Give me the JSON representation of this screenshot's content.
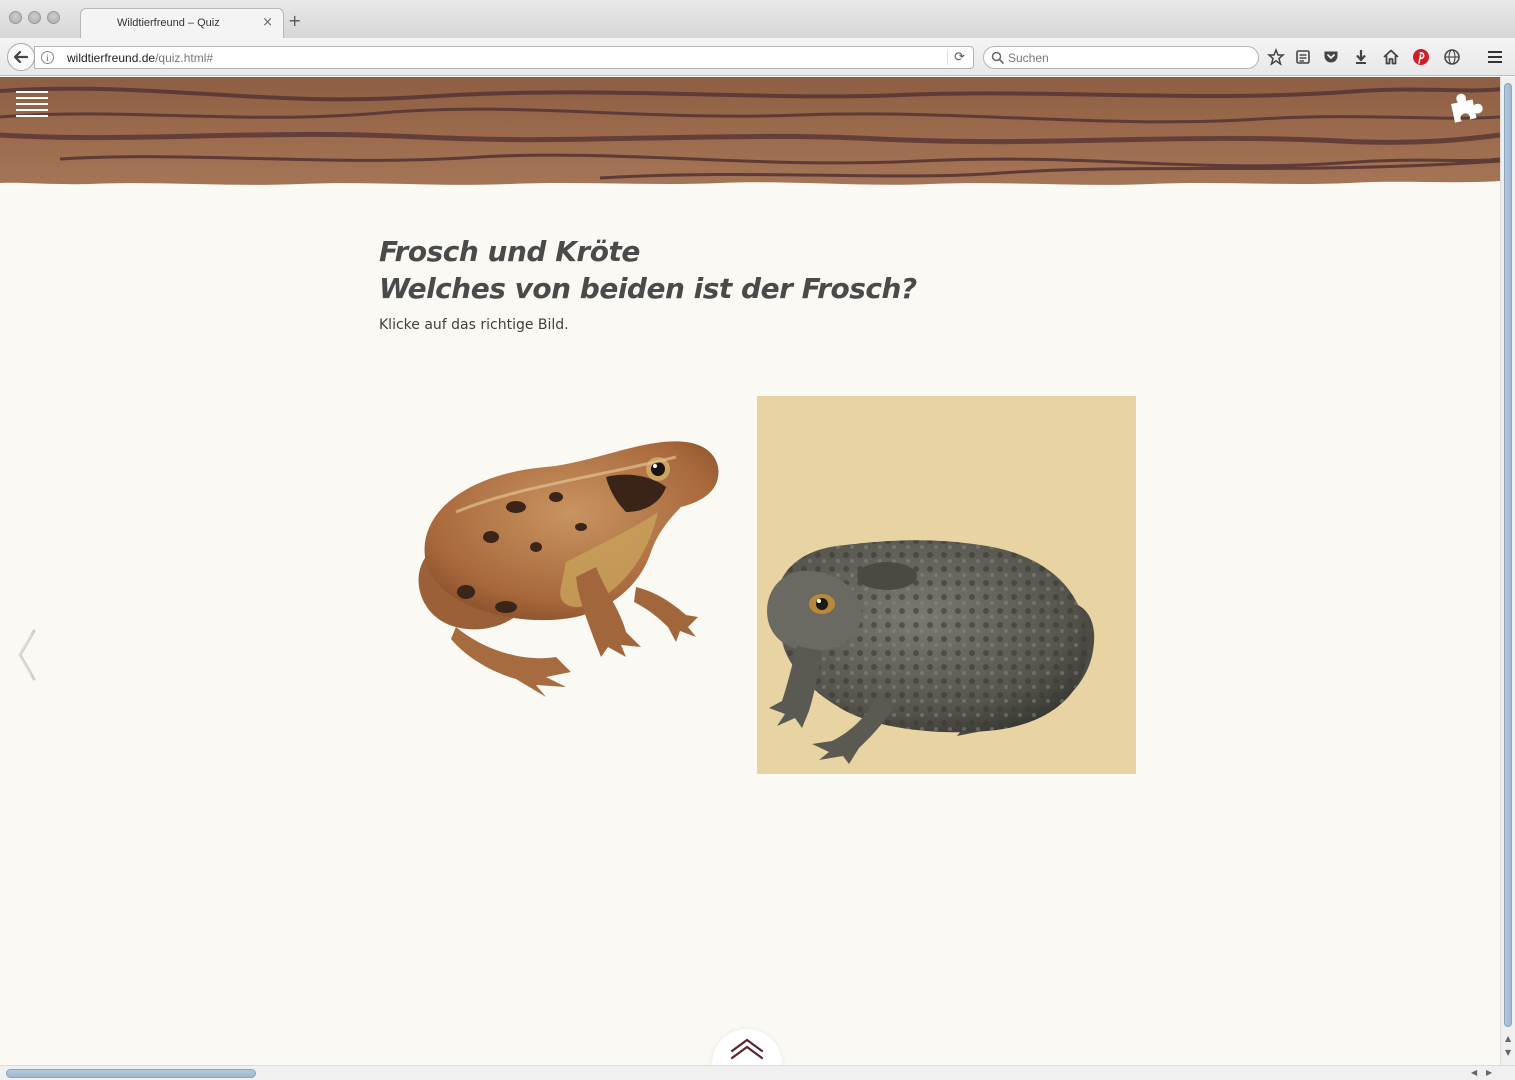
{
  "browser": {
    "tab_title": "Wildtierfreund – Quiz",
    "tab_close": "×",
    "new_tab": "+",
    "url_host": "wildtierfreund.de",
    "url_path": "/quiz.html#",
    "search_placeholder": "Suchen",
    "toolbar_icons": [
      "bookmark-star-icon",
      "reading-list-icon",
      "pocket-icon",
      "download-icon",
      "home-icon",
      "pinterest-icon",
      "web-icon",
      "menu-icon"
    ]
  },
  "page": {
    "title_line1": "Frosch und Kröte",
    "title_line2": "Welches von beiden ist der Frosch?",
    "hint": "Klicke auf das richtige Bild.",
    "choices": [
      {
        "animal": "frog",
        "image_name": "frog-illustration"
      },
      {
        "animal": "toad",
        "image_name": "toad-illustration"
      }
    ]
  },
  "colors": {
    "header_wood": "#8a5a3d",
    "page_bg": "#fbf9f4",
    "toad_bg": "#e8d3a3",
    "title_text": "#4a4a4a",
    "up_arrow": "#5a2430"
  }
}
